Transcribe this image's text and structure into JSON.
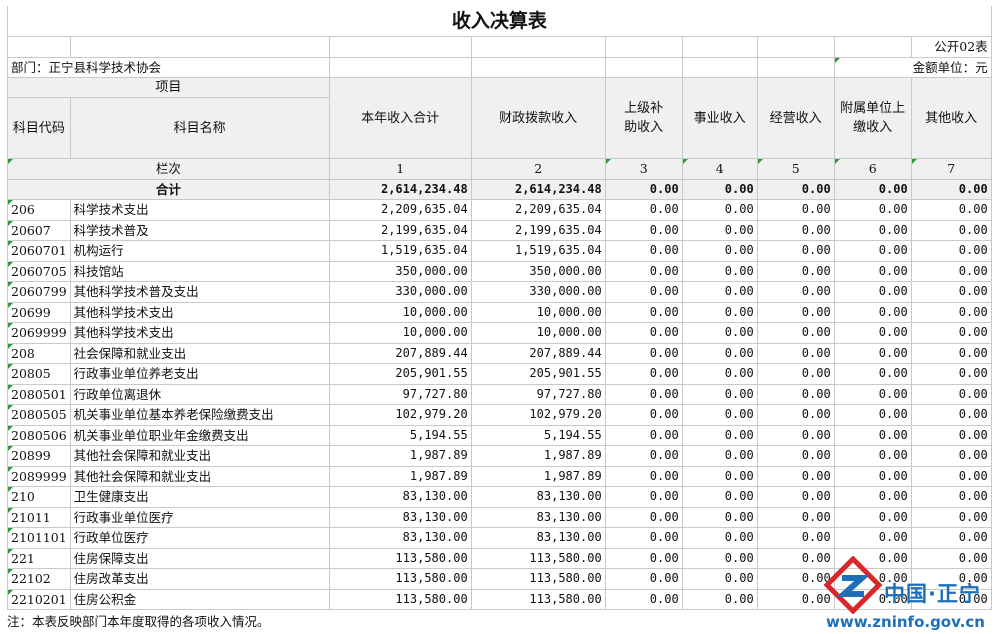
{
  "title": "收入决算表",
  "table_code": "公开02表",
  "department": "部门：正宁县科学技术协会",
  "unit": "金额单位：元",
  "headers": {
    "item": "项目",
    "code": "科目代码",
    "name": "科目名称",
    "total": "本年收入合计",
    "fiscal": "财政拨款收入",
    "superior": "上级补助收入",
    "career": "事业收入",
    "business": "经营收入",
    "affiliated": "附属单位上缴收入",
    "other": "其他收入",
    "lanci": "栏次",
    "col_numbers": [
      "1",
      "2",
      "3",
      "4",
      "5",
      "6",
      "7"
    ]
  },
  "total_row": {
    "label": "合计",
    "values": [
      "2,614,234.48",
      "2,614,234.48",
      "0.00",
      "0.00",
      "0.00",
      "0.00",
      "0.00"
    ]
  },
  "rows": [
    {
      "code": "206",
      "name": "科学技术支出",
      "total": "2,209,635.04",
      "fiscal": "2,209,635.04",
      "superior": "0.00",
      "career": "0.00",
      "business": "0.00",
      "affiliated": "0.00",
      "other": "0.00"
    },
    {
      "code": "20607",
      "name": "科学技术普及",
      "total": "2,199,635.04",
      "fiscal": "2,199,635.04",
      "superior": "0.00",
      "career": "0.00",
      "business": "0.00",
      "affiliated": "0.00",
      "other": "0.00"
    },
    {
      "code": "2060701",
      "name": "机构运行",
      "total": "1,519,635.04",
      "fiscal": "1,519,635.04",
      "superior": "0.00",
      "career": "0.00",
      "business": "0.00",
      "affiliated": "0.00",
      "other": "0.00"
    },
    {
      "code": "2060705",
      "name": "科技馆站",
      "total": "350,000.00",
      "fiscal": "350,000.00",
      "superior": "0.00",
      "career": "0.00",
      "business": "0.00",
      "affiliated": "0.00",
      "other": "0.00"
    },
    {
      "code": "2060799",
      "name": "其他科学技术普及支出",
      "total": "330,000.00",
      "fiscal": "330,000.00",
      "superior": "0.00",
      "career": "0.00",
      "business": "0.00",
      "affiliated": "0.00",
      "other": "0.00"
    },
    {
      "code": "20699",
      "name": "其他科学技术支出",
      "total": "10,000.00",
      "fiscal": "10,000.00",
      "superior": "0.00",
      "career": "0.00",
      "business": "0.00",
      "affiliated": "0.00",
      "other": "0.00"
    },
    {
      "code": "2069999",
      "name": "其他科学技术支出",
      "total": "10,000.00",
      "fiscal": "10,000.00",
      "superior": "0.00",
      "career": "0.00",
      "business": "0.00",
      "affiliated": "0.00",
      "other": "0.00"
    },
    {
      "code": "208",
      "name": "社会保障和就业支出",
      "total": "207,889.44",
      "fiscal": "207,889.44",
      "superior": "0.00",
      "career": "0.00",
      "business": "0.00",
      "affiliated": "0.00",
      "other": "0.00"
    },
    {
      "code": "20805",
      "name": "行政事业单位养老支出",
      "total": "205,901.55",
      "fiscal": "205,901.55",
      "superior": "0.00",
      "career": "0.00",
      "business": "0.00",
      "affiliated": "0.00",
      "other": "0.00"
    },
    {
      "code": "2080501",
      "name": "行政单位离退休",
      "total": "97,727.80",
      "fiscal": "97,727.80",
      "superior": "0.00",
      "career": "0.00",
      "business": "0.00",
      "affiliated": "0.00",
      "other": "0.00"
    },
    {
      "code": "2080505",
      "name": "机关事业单位基本养老保险缴费支出",
      "total": "102,979.20",
      "fiscal": "102,979.20",
      "superior": "0.00",
      "career": "0.00",
      "business": "0.00",
      "affiliated": "0.00",
      "other": "0.00"
    },
    {
      "code": "2080506",
      "name": "机关事业单位职业年金缴费支出",
      "total": "5,194.55",
      "fiscal": "5,194.55",
      "superior": "0.00",
      "career": "0.00",
      "business": "0.00",
      "affiliated": "0.00",
      "other": "0.00"
    },
    {
      "code": "20899",
      "name": "其他社会保障和就业支出",
      "total": "1,987.89",
      "fiscal": "1,987.89",
      "superior": "0.00",
      "career": "0.00",
      "business": "0.00",
      "affiliated": "0.00",
      "other": "0.00"
    },
    {
      "code": "2089999",
      "name": "其他社会保障和就业支出",
      "total": "1,987.89",
      "fiscal": "1,987.89",
      "superior": "0.00",
      "career": "0.00",
      "business": "0.00",
      "affiliated": "0.00",
      "other": "0.00"
    },
    {
      "code": "210",
      "name": "卫生健康支出",
      "total": "83,130.00",
      "fiscal": "83,130.00",
      "superior": "0.00",
      "career": "0.00",
      "business": "0.00",
      "affiliated": "0.00",
      "other": "0.00"
    },
    {
      "code": "21011",
      "name": "行政事业单位医疗",
      "total": "83,130.00",
      "fiscal": "83,130.00",
      "superior": "0.00",
      "career": "0.00",
      "business": "0.00",
      "affiliated": "0.00",
      "other": "0.00"
    },
    {
      "code": "2101101",
      "name": "行政单位医疗",
      "total": "83,130.00",
      "fiscal": "83,130.00",
      "superior": "0.00",
      "career": "0.00",
      "business": "0.00",
      "affiliated": "0.00",
      "other": "0.00"
    },
    {
      "code": "221",
      "name": "住房保障支出",
      "total": "113,580.00",
      "fiscal": "113,580.00",
      "superior": "0.00",
      "career": "0.00",
      "business": "0.00",
      "affiliated": "0.00",
      "other": "0.00"
    },
    {
      "code": "22102",
      "name": "住房改革支出",
      "total": "113,580.00",
      "fiscal": "113,580.00",
      "superior": "0.00",
      "career": "0.00",
      "business": "0.00",
      "affiliated": "0.00",
      "other": "0.00"
    },
    {
      "code": "2210201",
      "name": "住房公积金",
      "total": "113,580.00",
      "fiscal": "113,580.00",
      "superior": "0.00",
      "career": "0.00",
      "business": "0.00",
      "affiliated": "0.00",
      "other": "0.00"
    }
  ],
  "footnote": "注：本表反映部门本年度取得的各项收入情况。",
  "watermark": {
    "name": "中国·正宁",
    "url": "www.zninfo.gov.cn",
    "icon": "zn-logo-icon",
    "color": "#1e6fb8",
    "accent": "#d9262a"
  }
}
